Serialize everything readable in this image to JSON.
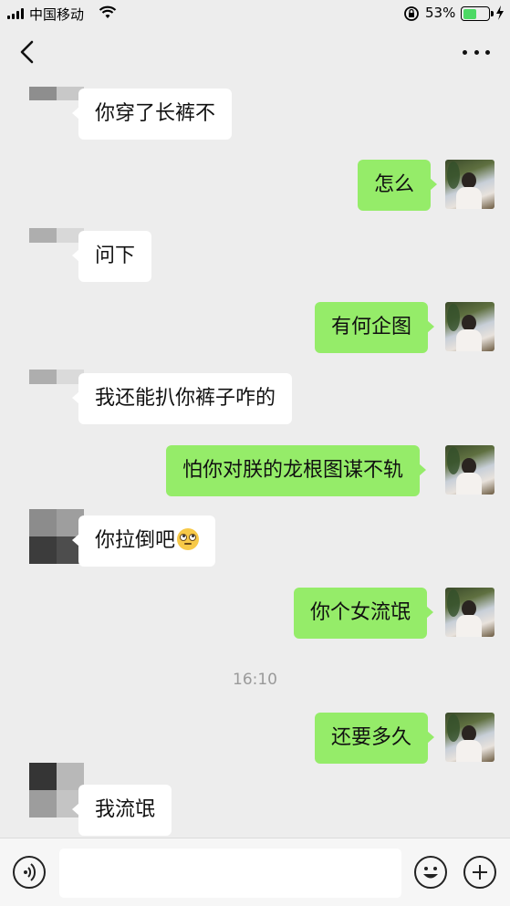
{
  "status_bar": {
    "carrier": "中国移动",
    "battery_percent": "53%",
    "battery_level": 0.53,
    "icons": [
      "signal-icon",
      "wifi-icon",
      "rotation-lock-icon",
      "battery-icon",
      "charging-icon"
    ]
  },
  "nav": {
    "back_icon": "chevron-left-icon",
    "more_icon": "more-dots-icon"
  },
  "messages": [
    {
      "side": "in",
      "text": "你穿了长裤不"
    },
    {
      "side": "out",
      "text": "怎么"
    },
    {
      "side": "in",
      "text": "问下"
    },
    {
      "side": "out",
      "text": "有何企图"
    },
    {
      "side": "in",
      "text": "我还能扒你裤子咋的"
    },
    {
      "side": "out",
      "text": "怕你对朕的龙根图谋不轨"
    },
    {
      "side": "in",
      "text": "你拉倒吧",
      "emoji": "eye-roll-emoji"
    },
    {
      "side": "out",
      "text": "你个女流氓"
    },
    {
      "side": "out",
      "text": "还要多久"
    },
    {
      "side": "in",
      "text": "我流氓"
    }
  ],
  "timestamp": "16:10",
  "input_bar": {
    "voice_icon": "voice-icon",
    "emoji_icon": "emoji-icon",
    "plus_icon": "plus-icon",
    "text_value": ""
  },
  "colors": {
    "background": "#ededed",
    "incoming_bubble": "#ffffff",
    "outgoing_bubble": "#95ec69",
    "battery_fill": "#4cd964"
  }
}
